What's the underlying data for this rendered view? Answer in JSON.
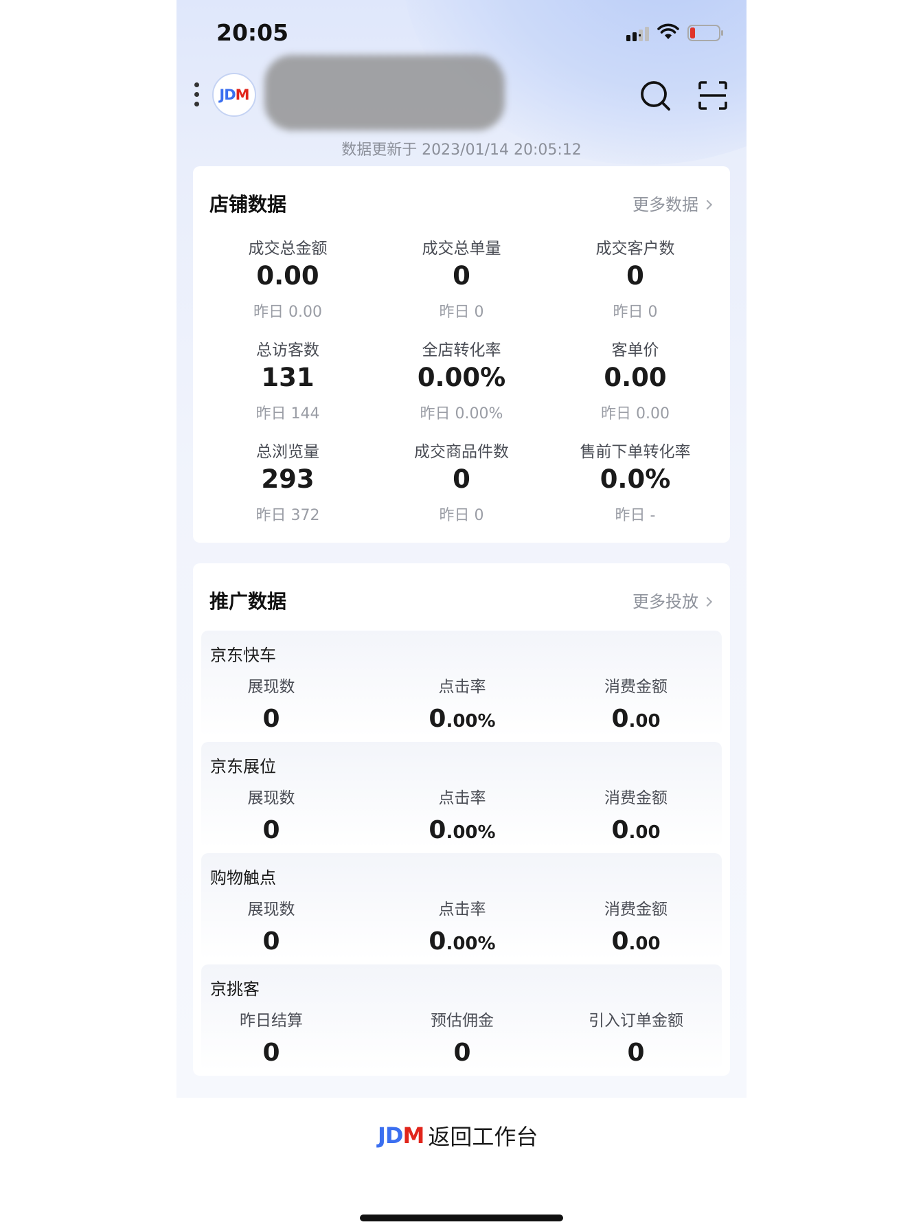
{
  "status_bar": {
    "time": "20:05"
  },
  "header": {
    "logo_text_jd": "JD",
    "logo_text_m": "M",
    "update_time": "数据更新于 2023/01/14 20:05:12"
  },
  "store_card": {
    "title": "店铺数据",
    "more": "更多数据",
    "metrics": [
      {
        "label": "成交总金额",
        "value": "0.00",
        "prev": "昨日 0.00"
      },
      {
        "label": "成交总单量",
        "value": "0",
        "prev": "昨日 0"
      },
      {
        "label": "成交客户数",
        "value": "0",
        "prev": "昨日 0"
      },
      {
        "label": "总访客数",
        "value": "131",
        "prev": "昨日 144"
      },
      {
        "label": "全店转化率",
        "value": "0.00%",
        "prev": "昨日 0.00%"
      },
      {
        "label": "客单价",
        "value": "0.00",
        "prev": "昨日 0.00"
      },
      {
        "label": "总浏览量",
        "value": "293",
        "prev": "昨日 372"
      },
      {
        "label": "成交商品件数",
        "value": "0",
        "prev": "昨日 0"
      },
      {
        "label": "售前下单转化率",
        "value": "0.0%",
        "prev": "昨日 -"
      }
    ]
  },
  "promo_card": {
    "title": "推广数据",
    "more": "更多投放",
    "sections": [
      {
        "title": "京东快车",
        "metrics": [
          {
            "label": "展现数",
            "value_main": "0",
            "value_sub": ""
          },
          {
            "label": "点击率",
            "value_main": "0",
            "value_sub": ".00%"
          },
          {
            "label": "消费金额",
            "value_main": "0",
            "value_sub": ".00"
          }
        ]
      },
      {
        "title": "京东展位",
        "metrics": [
          {
            "label": "展现数",
            "value_main": "0",
            "value_sub": ""
          },
          {
            "label": "点击率",
            "value_main": "0",
            "value_sub": ".00%"
          },
          {
            "label": "消费金额",
            "value_main": "0",
            "value_sub": ".00"
          }
        ]
      },
      {
        "title": "购物触点",
        "metrics": [
          {
            "label": "展现数",
            "value_main": "0",
            "value_sub": ""
          },
          {
            "label": "点击率",
            "value_main": "0",
            "value_sub": ".00%"
          },
          {
            "label": "消费金额",
            "value_main": "0",
            "value_sub": ".00"
          }
        ]
      },
      {
        "title": "京挑客",
        "metrics": [
          {
            "label": "昨日结算",
            "value_main": "0",
            "value_sub": ""
          },
          {
            "label": "预估佣金",
            "value_main": "0",
            "value_sub": ""
          },
          {
            "label": "引入订单金额",
            "value_main": "0",
            "value_sub": ""
          }
        ]
      }
    ]
  },
  "bottom_bar": {
    "logo_text_jd": "JD",
    "logo_text_m": "M",
    "back_label": "返回工作台"
  },
  "icons": {
    "menu": "more-vertical-icon",
    "search": "search-icon",
    "scan": "scan-icon",
    "chevron": "chevron-right-icon"
  },
  "colors": {
    "brand_blue": "#3b6ff0",
    "brand_red": "#e1251b",
    "battery_low": "#e0342b"
  }
}
